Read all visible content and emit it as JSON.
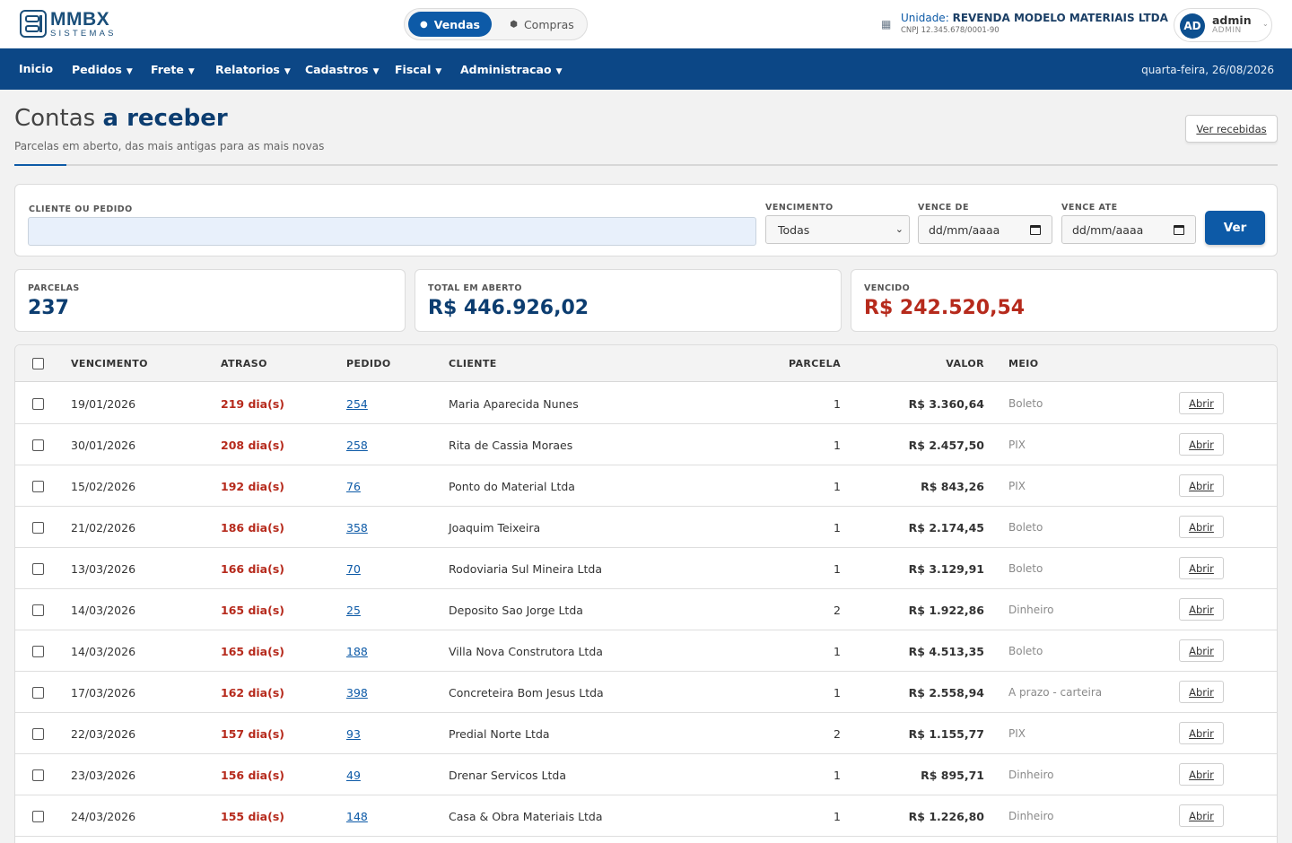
{
  "brand": {
    "name": "MMBX",
    "sub": "SISTEMAS"
  },
  "mode_switch": {
    "active": "Vendas",
    "inactive": "Compras"
  },
  "unit": {
    "prefix": "Unidade:",
    "name": "REVENDA MODELO MATERIAIS LTDA",
    "cnpj": "CNPJ 12.345.678/0001-90"
  },
  "user": {
    "initials": "AD",
    "name": "admin",
    "role": "ADMIN"
  },
  "nav": {
    "items": [
      "Inicio",
      "Pedidos",
      "Frete",
      "Relatorios",
      "Cadastros",
      "Fiscal",
      "Administracao"
    ],
    "date": "quarta-feira, 26/08/2026"
  },
  "page": {
    "title_light": "Contas",
    "title_bold": "a receber",
    "subtitle": "Parcelas em aberto, das mais antigas para as mais novas",
    "received_button": "Ver recebidas"
  },
  "filters": {
    "client_label": "CLIENTE OU PEDIDO",
    "client_value": "",
    "due_label": "VENCIMENTO",
    "due_value": "Todas",
    "from_label": "VENCE DE",
    "from_value": "dd/mm/aaaa",
    "to_label": "VENCE ATE",
    "to_value": "dd/mm/aaaa",
    "submit": "Ver"
  },
  "stats": [
    {
      "label": "PARCELAS",
      "value": "237"
    },
    {
      "label": "TOTAL EM ABERTO",
      "value": "R$ 446.926,02"
    },
    {
      "label": "VENCIDO",
      "value": "R$ 242.520,54"
    }
  ],
  "table": {
    "headers": [
      "VENCIMENTO",
      "ATRASO",
      "PEDIDO",
      "CLIENTE",
      "PARCELA",
      "VALOR",
      "MEIO"
    ],
    "action_label": "Abrir",
    "rows": [
      {
        "venc": "19/01/2026",
        "atraso": "219 dia(s)",
        "pedido": "254",
        "cliente": "Maria Aparecida Nunes",
        "parcela": "1",
        "valor": "R$ 3.360,64",
        "meio": "Boleto"
      },
      {
        "venc": "30/01/2026",
        "atraso": "208 dia(s)",
        "pedido": "258",
        "cliente": "Rita de Cassia Moraes",
        "parcela": "1",
        "valor": "R$ 2.457,50",
        "meio": "PIX"
      },
      {
        "venc": "15/02/2026",
        "atraso": "192 dia(s)",
        "pedido": "76",
        "cliente": "Ponto do Material Ltda",
        "parcela": "1",
        "valor": "R$ 843,26",
        "meio": "PIX"
      },
      {
        "venc": "21/02/2026",
        "atraso": "186 dia(s)",
        "pedido": "358",
        "cliente": "Joaquim Teixeira",
        "parcela": "1",
        "valor": "R$ 2.174,45",
        "meio": "Boleto"
      },
      {
        "venc": "13/03/2026",
        "atraso": "166 dia(s)",
        "pedido": "70",
        "cliente": "Rodoviaria Sul Mineira Ltda",
        "parcela": "1",
        "valor": "R$ 3.129,91",
        "meio": "Boleto"
      },
      {
        "venc": "14/03/2026",
        "atraso": "165 dia(s)",
        "pedido": "25",
        "cliente": "Deposito Sao Jorge Ltda",
        "parcela": "2",
        "valor": "R$ 1.922,86",
        "meio": "Dinheiro"
      },
      {
        "venc": "14/03/2026",
        "atraso": "165 dia(s)",
        "pedido": "188",
        "cliente": "Villa Nova Construtora Ltda",
        "parcela": "1",
        "valor": "R$ 4.513,35",
        "meio": "Boleto"
      },
      {
        "venc": "17/03/2026",
        "atraso": "162 dia(s)",
        "pedido": "398",
        "cliente": "Concreteira Bom Jesus Ltda",
        "parcela": "1",
        "valor": "R$ 2.558,94",
        "meio": "A prazo - carteira"
      },
      {
        "venc": "22/03/2026",
        "atraso": "157 dia(s)",
        "pedido": "93",
        "cliente": "Predial Norte Ltda",
        "parcela": "2",
        "valor": "R$ 1.155,77",
        "meio": "PIX"
      },
      {
        "venc": "23/03/2026",
        "atraso": "156 dia(s)",
        "pedido": "49",
        "cliente": "Drenar Servicos Ltda",
        "parcela": "1",
        "valor": "R$ 895,71",
        "meio": "Dinheiro"
      },
      {
        "venc": "24/03/2026",
        "atraso": "155 dia(s)",
        "pedido": "148",
        "cliente": "Casa & Obra Materiais Ltda",
        "parcela": "1",
        "valor": "R$ 1.226,80",
        "meio": "Dinheiro"
      }
    ]
  },
  "colors": {
    "primary": "#0d5aa7",
    "nav": "#0c4786",
    "title": "#0c3d70",
    "danger": "#b62a1c"
  }
}
